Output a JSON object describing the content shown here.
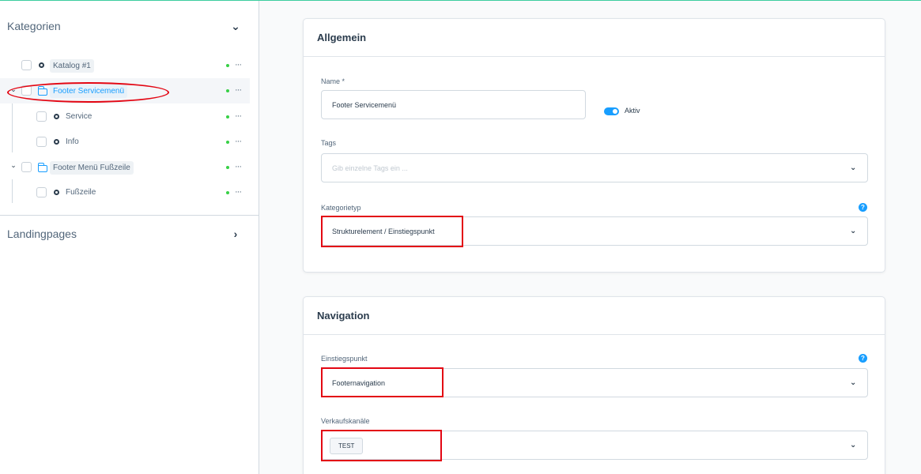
{
  "sidebar": {
    "categories_title": "Kategorien",
    "landing_title": "Landingpages",
    "tree": {
      "katalog": "Katalog #1",
      "footer_service": "Footer Servicemenü",
      "service": "Service",
      "info": "Info",
      "footer_menu": "Footer Menü Fußzeile",
      "fusszeile": "Fußzeile"
    },
    "more_glyph": "···"
  },
  "general": {
    "title": "Allgemein",
    "name_label": "Name",
    "name_required": "*",
    "name_value": "Footer Servicemenü",
    "active_label": "Aktiv",
    "tags_label": "Tags",
    "tags_placeholder": "Gib einzelne Tags ein ...",
    "type_label": "Kategorietyp",
    "type_value": "Strukturelement / Einstiegspunkt"
  },
  "navigation": {
    "title": "Navigation",
    "entry_label": "Einstiegspunkt",
    "entry_value": "Footernavigation",
    "channels_label": "Verkaufskanäle",
    "channel_chip": "TEST"
  },
  "colors": {
    "accent": "#189eff",
    "annotation_red": "#e30613",
    "status_green": "#37d046"
  }
}
